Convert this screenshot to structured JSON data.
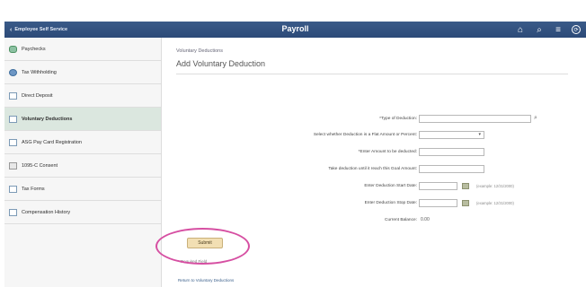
{
  "topbar": {
    "back_label": "Employee Self Service",
    "title": "Payroll",
    "icons": [
      "home-icon",
      "search-icon",
      "menu-icon",
      "navbar-icon"
    ]
  },
  "sidebar": {
    "items": [
      {
        "label": "Paychecks",
        "icon": "money-icon",
        "active": false
      },
      {
        "label": "Tax Withholding",
        "icon": "tax-icon",
        "active": false
      },
      {
        "label": "Direct Deposit",
        "icon": "document-icon",
        "active": false
      },
      {
        "label": "Voluntary Deductions",
        "icon": "document-icon",
        "active": true
      },
      {
        "label": "ASG Pay Card Registration",
        "icon": "document-icon",
        "active": false
      },
      {
        "label": "1095-C Consent",
        "icon": "pen-icon",
        "active": false
      },
      {
        "label": "Tax Forms",
        "icon": "document-icon",
        "active": false
      },
      {
        "label": "Compensation History",
        "icon": "document-icon",
        "active": false
      }
    ]
  },
  "main": {
    "breadcrumb": "Voluntary Deductions",
    "title": "Add Voluntary Deduction",
    "form": {
      "type_label": "*Type of Deduction:",
      "type_value": "",
      "amount_type_label": "Select whether Deduction is a Flat Amount or Percent:",
      "amount_type_value": "",
      "amount_label": "*Enter Amount to be deducted:",
      "amount_value": "",
      "goal_label": "Take deduction until it reach this Goal Amount:",
      "goal_value": "",
      "start_label": "Enter Deduction Start Date:",
      "start_value": "",
      "start_example": "(example: 12/31/2000)",
      "stop_label": "Enter Deduction Stop Date:",
      "stop_value": "",
      "stop_example": "(example: 12/31/2000)",
      "balance_label": "Current Balance:",
      "balance_value": "0.00"
    },
    "submit_label": "Submit",
    "required_text": "* Required Field",
    "return_link": "Return to Voluntary Deductions"
  },
  "colors": {
    "topbar": "#2f4f7f",
    "highlight_circle": "#d64fa2",
    "submit_button": "#f2dfb3"
  }
}
